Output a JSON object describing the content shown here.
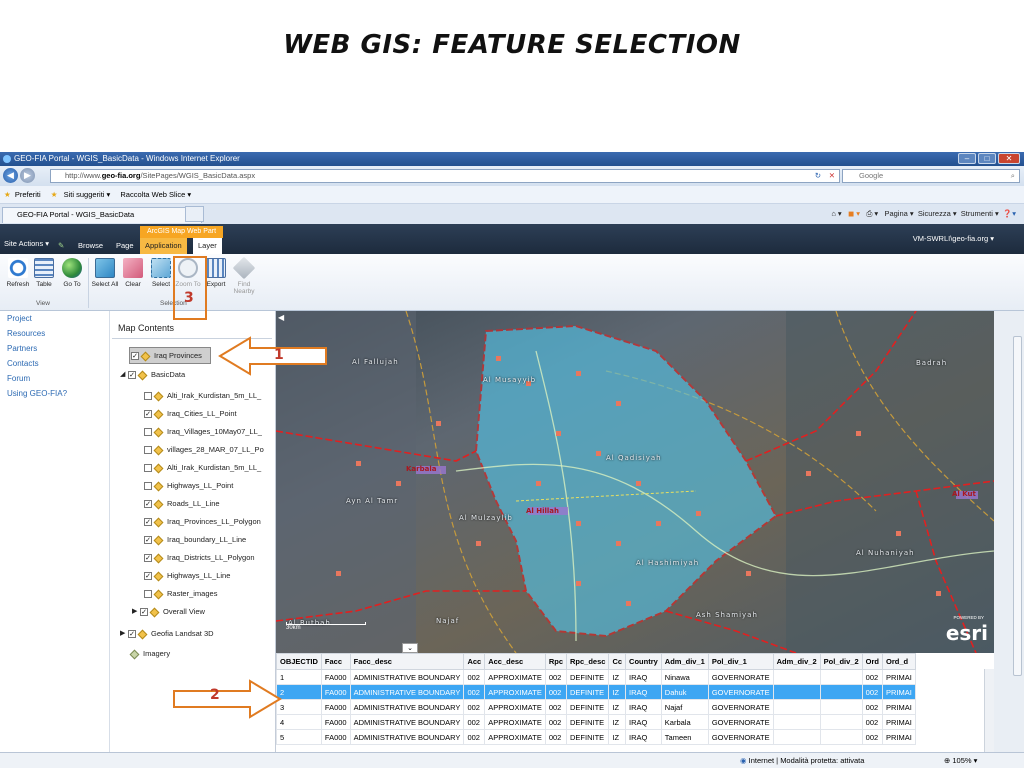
{
  "slide": {
    "title": "WEB GIS: FEATURE SELECTION"
  },
  "browser": {
    "title": "GEO-FIA Portal - WGIS_BasicData - Windows Internet Explorer",
    "url_prefix": "http://www.",
    "url_domain": "geo-fia.org",
    "url_path": "/SitePages/WGIS_BasicData.aspx",
    "search_placeholder": "Google",
    "favorites": [
      "Preferiti",
      "Siti suggeriti ▾",
      "Raccolta Web Slice ▾"
    ],
    "tab_title": "GEO-FIA Portal - WGIS_BasicData",
    "command_items": [
      "Pagina ▾",
      "Sicurezza ▾",
      "Strumenti ▾"
    ],
    "status_text": "Internet | Modalità protetta: attivata",
    "zoom": "105%"
  },
  "sharepoint": {
    "site_actions": "Site Actions ▾",
    "tabs": [
      "Browse",
      "Page"
    ],
    "contextual_group": "ArcGIS Map Web Part",
    "contextual_tabs": [
      "Application",
      "Layer"
    ],
    "user": "VM-SWRLI\\geo-fia.org ▾",
    "ribbon_buttons": [
      {
        "label": "Refresh",
        "icon": "refresh-icon"
      },
      {
        "label": "Table",
        "icon": "table-icon"
      },
      {
        "label": "Go To",
        "icon": "globe-icon"
      },
      {
        "label": "Select All",
        "icon": "select-all-icon"
      },
      {
        "label": "Clear",
        "icon": "clear-icon"
      },
      {
        "label": "Select",
        "icon": "select-icon"
      },
      {
        "label": "Zoom To",
        "icon": "zoom-to-icon"
      },
      {
        "label": "Export",
        "icon": "export-icon"
      },
      {
        "label": "Find Nearby",
        "icon": "find-nearby-icon"
      }
    ],
    "group_labels": [
      "View",
      "Selection"
    ]
  },
  "leftnav": {
    "items": [
      "Project",
      "Resources",
      "Partners",
      "Contacts",
      "Forum",
      "Using GEO-FIA?"
    ]
  },
  "map_contents": {
    "title": "Map Contents",
    "selected_layer": "Iraq Provinces",
    "groups": [
      {
        "name": "BasicData",
        "checked": true,
        "expanded": true
      },
      {
        "name": "Geofia Landsat 3D",
        "checked": true,
        "expanded": false
      },
      {
        "name": "Imagery",
        "checked": false,
        "expanded": false
      }
    ],
    "layers": [
      {
        "name": "Alti_Irak_Kurdistan_5m_LL_",
        "checked": false
      },
      {
        "name": "Iraq_Cities_LL_Point",
        "checked": true
      },
      {
        "name": "Iraq_Villages_10May07_LL_",
        "checked": false
      },
      {
        "name": "villages_28_MAR_07_LL_Po",
        "checked": false
      },
      {
        "name": "Alti_Irak_Kurdistan_5m_LL_",
        "checked": false
      },
      {
        "name": "Highways_LL_Point",
        "checked": false
      },
      {
        "name": "Roads_LL_Line",
        "checked": true
      },
      {
        "name": "Iraq_Provinces_LL_Polygon",
        "checked": true
      },
      {
        "name": "Iraq_boundary_LL_Line",
        "checked": true
      },
      {
        "name": "Iraq_Districts_LL_Polygon",
        "checked": true
      },
      {
        "name": "Highways_LL_Line",
        "checked": true
      },
      {
        "name": "Raster_images",
        "checked": false
      },
      {
        "name": "Overall View",
        "checked": true
      }
    ]
  },
  "map": {
    "labels": [
      "Al Fallujah",
      "Al Musayyib",
      "Ayn Al Tamr",
      "Al Mulzaylib",
      "Al Rutbah",
      "Najaf",
      "Badrah",
      "Al Hillah",
      "Karbala",
      "Al Kut",
      "Al Qadisiyah",
      "Al Hashimiyah",
      "Ash Shamiyah",
      "Al Nuhaniyah"
    ],
    "red_labels": [
      "Karbala",
      "Al Hillah",
      "Al Kut"
    ],
    "scale": "30km",
    "logo": "esri",
    "powered_by": "POWERED BY"
  },
  "attributes": {
    "columns": [
      "OBJECTID",
      "Facc",
      "Facc_desc",
      "Acc",
      "Acc_desc",
      "Rpc",
      "Rpc_desc",
      "Cc",
      "Country",
      "Adm_div_1",
      "Pol_div_1",
      "Adm_div_2",
      "Pol_div_2",
      "Ord",
      "Ord_d"
    ],
    "rows": [
      [
        "1",
        "FA000",
        "ADMINISTRATIVE BOUNDARY",
        "002",
        "APPROXIMATE",
        "002",
        "DEFINITE",
        "IZ",
        "IRAQ",
        "Ninawa",
        "GOVERNORATE",
        "",
        "",
        "002",
        "PRIMAI"
      ],
      [
        "2",
        "FA000",
        "ADMINISTRATIVE BOUNDARY",
        "002",
        "APPROXIMATE",
        "002",
        "DEFINITE",
        "IZ",
        "IRAQ",
        "Dahuk",
        "GOVERNORATE",
        "",
        "",
        "002",
        "PRIMAI"
      ],
      [
        "3",
        "FA000",
        "ADMINISTRATIVE BOUNDARY",
        "002",
        "APPROXIMATE",
        "002",
        "DEFINITE",
        "IZ",
        "IRAQ",
        "Najaf",
        "GOVERNORATE",
        "",
        "",
        "002",
        "PRIMAI"
      ],
      [
        "4",
        "FA000",
        "ADMINISTRATIVE BOUNDARY",
        "002",
        "APPROXIMATE",
        "002",
        "DEFINITE",
        "IZ",
        "IRAQ",
        "Karbala",
        "GOVERNORATE",
        "",
        "",
        "002",
        "PRIMAI"
      ],
      [
        "5",
        "FA000",
        "ADMINISTRATIVE BOUNDARY",
        "002",
        "APPROXIMATE",
        "002",
        "DEFINITE",
        "IZ",
        "IRAQ",
        "Tameen",
        "GOVERNORATE",
        "",
        "",
        "002",
        "PRIMAI"
      ]
    ],
    "selected_row": 2
  },
  "annotations": {
    "callout_1": "1",
    "callout_2": "2",
    "callout_3": "3",
    "accent": "#e07b21"
  }
}
